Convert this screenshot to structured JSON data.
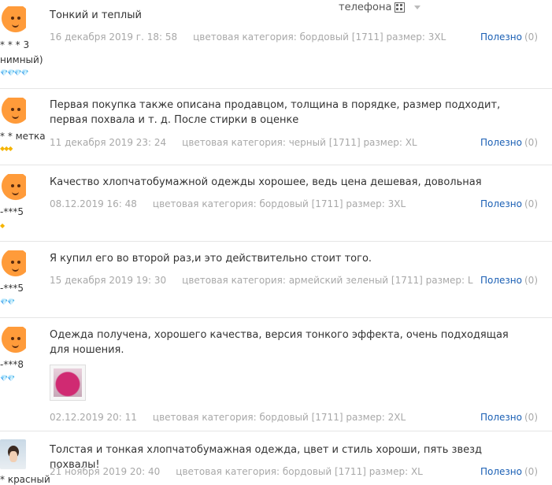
{
  "header": {
    "phone_label": "телефона"
  },
  "reviews": [
    {
      "user": "* * * 3",
      "user_line2": "нимный)",
      "level": "💎💎💎💎",
      "level_type": "red",
      "text": "Тонкий и теплый",
      "date": "16 декабря 2019 г. 18: 58",
      "category": "цветовая категория: бордовый [1711] размер: 3XL",
      "useful_label": "Полезно",
      "useful_count": "(0)"
    },
    {
      "user": "* * метка",
      "level": "◆◆◆",
      "level_type": "gold",
      "text": "Первая покупка также описана продавцом, толщина в порядке, размер подходит, первая похвала и т. д. После стирки в оценке",
      "date": "11 декабря 2019 23: 24",
      "category": "цветовая категория: черный [1711] размер: XL",
      "useful_label": "Полезно",
      "useful_count": "(0)"
    },
    {
      "user": "-***5",
      "level": "◆",
      "level_type": "gold",
      "text": "Качество хлопчатобумажной одежды хорошее, ведь цена дешевая, довольная",
      "date": "08.12.2019 16: 48",
      "category": "цветовая категория: бордовый [1711] размер: 3XL",
      "useful_label": "Полезно",
      "useful_count": "(0)"
    },
    {
      "user": "-***5",
      "level": "💎💎",
      "level_type": "red",
      "text": "Я купил его во второй раз,и это действительно стоит того.",
      "date": "15 декабря 2019 19: 30",
      "category": "цветовая категория: армейский зеленый [1711] размер: L",
      "useful_label": "Полезно",
      "useful_count": "(0)"
    },
    {
      "user": "-***8",
      "level": "💎💎",
      "level_type": "red",
      "text": "Одежда получена, хорошего качества, версия тонкого эффекта, очень подходящая для ношения.",
      "date": "02.12.2019 20: 11",
      "category": "цветовая категория: бордовый [1711] размер: 2XL",
      "useful_label": "Полезно",
      "useful_count": "(0)"
    },
    {
      "user": "* красный",
      "text": "Толстая и тонкая хлопчатобумажная одежда, цвет и стиль хороши, пять звезд похвалы!",
      "date": "21 ноября 2019 20: 40",
      "category": "цветовая категория: бордовый [1711] размер: XL",
      "useful_label": "Полезно",
      "useful_count": "(0)"
    }
  ]
}
